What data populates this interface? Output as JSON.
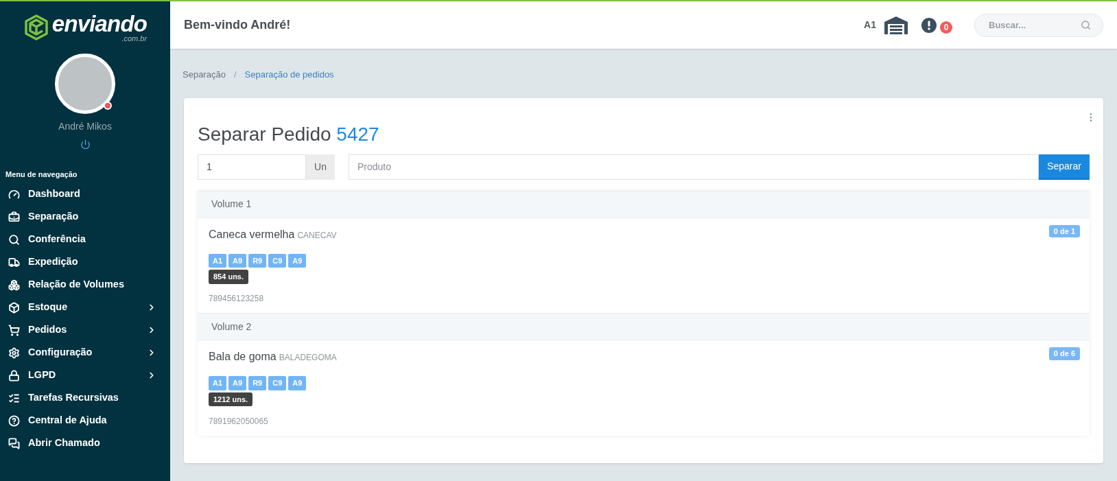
{
  "sidebar": {
    "logo": {
      "name": "enviando",
      "domain": ".com.br"
    },
    "user": {
      "name": "André Mikos",
      "online": false
    },
    "menu_title": "Menu de navegação",
    "items": [
      {
        "label": "Dashboard",
        "submenu": false
      },
      {
        "label": "Separação",
        "submenu": false
      },
      {
        "label": "Conferência",
        "submenu": false
      },
      {
        "label": "Expedição",
        "submenu": false
      },
      {
        "label": "Relação de Volumes",
        "submenu": false
      },
      {
        "label": "Estoque",
        "submenu": true
      },
      {
        "label": "Pedidos",
        "submenu": true
      },
      {
        "label": "Configuração",
        "submenu": true
      },
      {
        "label": "LGPD",
        "submenu": true
      },
      {
        "label": "Tarefas Recursivas",
        "submenu": false
      },
      {
        "label": "Central de Ajuda",
        "submenu": false
      },
      {
        "label": "Abrir Chamado",
        "submenu": false
      }
    ]
  },
  "header": {
    "greeting": "Bem-vindo André!",
    "location": "A1",
    "alerts_count": "0",
    "search": {
      "placeholder": "Buscar..."
    }
  },
  "breadcrumb_separator": "/",
  "breadcrumb": [
    {
      "label": "Separação",
      "selected": false
    },
    {
      "label": "Separação de pedidos",
      "selected": true
    }
  ],
  "card": {
    "title": "Separar Pedido",
    "order_number": "5427",
    "quantity": {
      "value": "1",
      "unit": "Un"
    },
    "product": {
      "placeholder": "Produto"
    },
    "submit": "Separar",
    "volumes": [
      {
        "title": "Volume 1",
        "product": "Caneca vermelha",
        "code": "CANECAV",
        "progress": "0 de 1",
        "locations": [
          "A1",
          "A9",
          "R9",
          "C9",
          "A9"
        ],
        "stock": "854 uns.",
        "barcode": "789456123258"
      },
      {
        "title": "Volume 2",
        "product": "Bala de goma",
        "code": "BALADEGOMA",
        "progress": "0 de 6",
        "locations": [
          "A1",
          "A9",
          "R9",
          "C9",
          "A9"
        ],
        "stock": "1212 uns.",
        "barcode": "7891962050065"
      }
    ]
  }
}
